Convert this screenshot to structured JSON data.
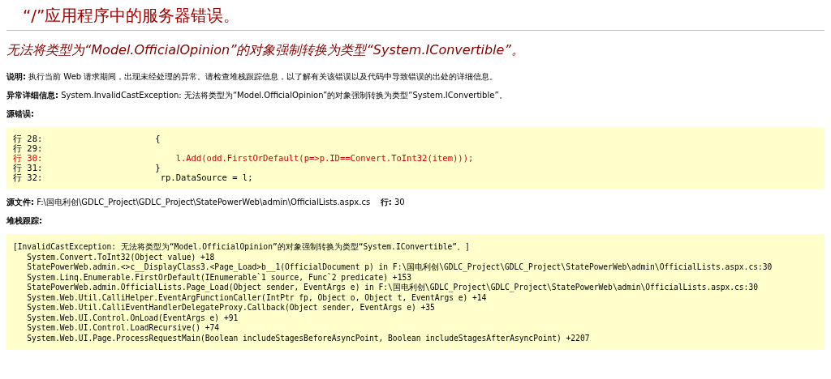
{
  "page_title": "“/”应用程序中的服务器错误。",
  "error_title": "无法将类型为“Model.OfficialOpinion”的对象强制转换为类型“System.IConvertible”。",
  "description": "**说明:** 执行当前 Web 请求期间，出现未经处理的异常。请检查堆栈跟踪信息，以了解有关该错误以及代码中导致错误的出处的详细信息。",
  "exception_details": "**异常详细信息:** System.InvalidCastException: 无法将类型为“Model.OfficialOpinion”的对象强制转换为类型“System.IConvertible”。",
  "source_error_heading": "源错误:",
  "source_lines": [
    {
      "label": "行 28:",
      "code": "            {",
      "highlighted": false
    },
    {
      "label": "行 29:",
      "highlighted": false
    },
    {
      "label": "行 30:",
      "code": "                l.Add(odd.FirstOrDefault(p=>p.ID==Convert.ToInt32(item)));",
      "highlighted": true
    },
    {
      "label": "行 31:",
      "code": "            }",
      "highlighted": false
    },
    {
      "label": "行 32:",
      "code": "             rp.DataSource = l;",
      "highlighted": false
    }
  ],
  "source_file": "**源文件:** F:\\国电利创\\GDLC_Project\\GDLC_Project\\StatePowerWeb\\admin\\OfficialLists.aspx.cs    **行:** 30",
  "stack_heading": "堆栈跟踪:",
  "stack_lines": [
    "[InvalidCastException: 无法将类型为“Model.OfficialOpinion”的对象强制转换为类型“System.IConvertible”。]",
    "   System.Convert.ToInt32(Object value) +18",
    "   StatePowerWeb.admin.<>c__DisplayClass3.<Page_Load>b__1(OfficialDocument p) in F:\\国电利创\\GDLC_Project\\GDLC_Project\\StatePowerWeb\\admin\\OfficialLists.aspx.cs:30",
    "   System.Linq.Enumerable.FirstOrDefault(IEnumerable`1 source, Func`2 predicate) +153",
    "   StatePowerWeb.admin.OfficialLists.Page_Load(Object sender, EventArgs e) in F:\\国电利创\\GDLC_Project\\GDLC_Project\\StatePowerWeb\\admin\\OfficialLists.aspx.cs:30",
    "   System.Web.Util.CalliHelper.EventArgFunctionCaller(IntPtr fp, Object o, Object t, EventArgs e) +14",
    "   System.Web.Util.CalliEventHandlerDelegateProxy.Callback(Object sender, EventArgs e) +35",
    "   System.Web.UI.Control.OnLoad(EventArgs e) +91",
    "   System.Web.UI.Control.LoadRecursive() +74",
    "   System.Web.UI.Page.ProcessRequestMain(Boolean includeStagesBeforeAsyncPoint, Boolean includeStagesAfterAsyncPoint) +2207"
  ]
}
